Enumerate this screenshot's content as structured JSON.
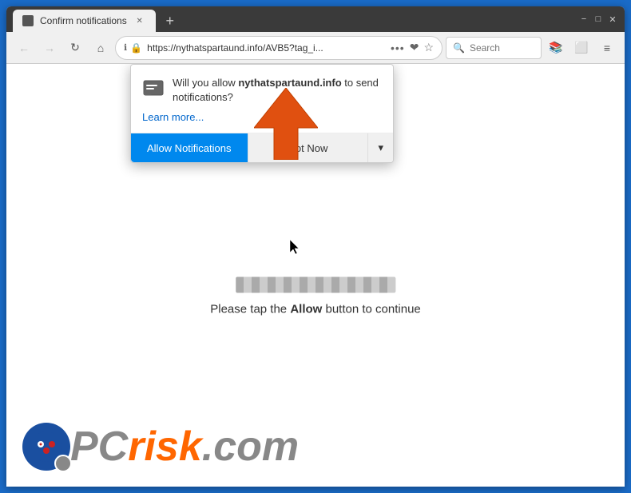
{
  "browser": {
    "tab": {
      "title": "Confirm notifications",
      "favicon": "page-icon"
    },
    "new_tab_label": "+",
    "window_controls": {
      "minimize": "−",
      "maximize": "□",
      "close": "✕"
    },
    "nav": {
      "back": "←",
      "forward": "→",
      "refresh": "↻",
      "home": "⌂",
      "address": "https://nythatspartaund.info/AVB5?tag_i...",
      "more": "•••",
      "bookmark_icon": "☆",
      "pocket_icon": "❤",
      "lock_icon": "🔒"
    },
    "search": {
      "placeholder": "Search",
      "value": ""
    },
    "nav_right": {
      "library": "📚",
      "sync": "□",
      "menu": "≡"
    }
  },
  "notification_popup": {
    "message_before": "Will you allow ",
    "site_name": "nythatspartaund.info",
    "message_after": " to send notifications?",
    "learn_more": "Learn more...",
    "allow_button": "Allow Notifications",
    "not_now_button": "Not Now",
    "dropdown_icon": "▾"
  },
  "page": {
    "message_before": "Please tap the ",
    "allow_word": "Allow",
    "message_after": " button to continue"
  },
  "logo": {
    "pc": "PC",
    "risk": "risk",
    "dot_com": ".com"
  }
}
